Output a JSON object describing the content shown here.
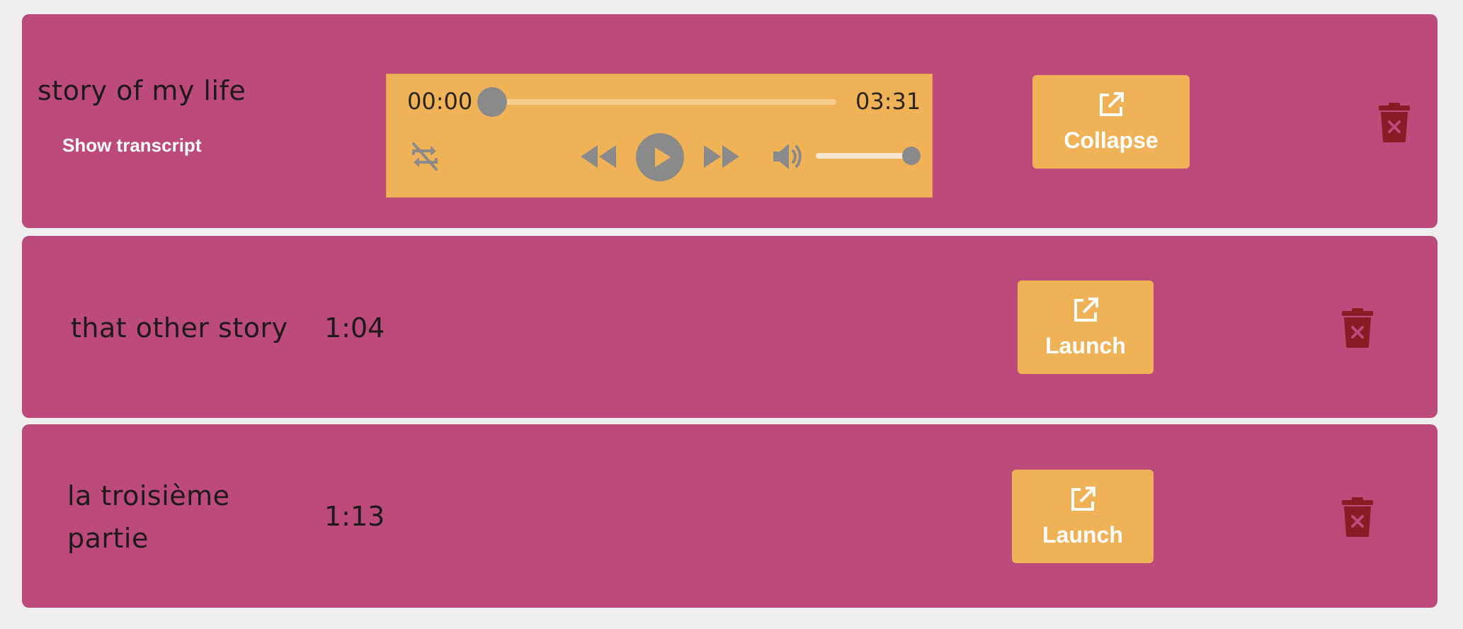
{
  "colors": {
    "card": "#bc4b7b",
    "button": "#f0b257",
    "trash": "#8a1a24",
    "control_gray": "#8a8a8a"
  },
  "items": [
    {
      "title": "story of my life",
      "show_transcript_label": "Show transcript",
      "action_label": "Collapse",
      "action_icon": "external-link-icon",
      "delete_icon": "trash-icon",
      "player": {
        "current_time": "00:00",
        "total_time": "03:31",
        "progress_fraction": 0,
        "volume_fraction": 1,
        "icons": [
          "loop-off-icon",
          "rewind-icon",
          "play-icon",
          "fast-forward-icon",
          "volume-icon"
        ]
      }
    },
    {
      "title": "that other story",
      "duration": "1:04",
      "action_label": "Launch",
      "action_icon": "external-link-icon",
      "delete_icon": "trash-icon"
    },
    {
      "title_line1": "la troisième",
      "title_line2": "partie",
      "duration": "1:13",
      "action_label": "Launch",
      "action_icon": "external-link-icon",
      "delete_icon": "trash-icon"
    }
  ]
}
